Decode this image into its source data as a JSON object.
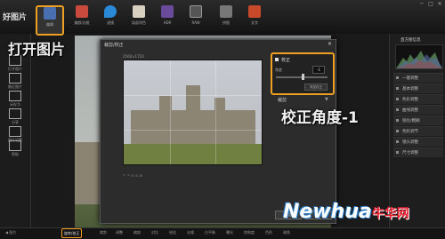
{
  "app": {
    "logo": "好图片",
    "window_controls": [
      "─",
      "□",
      "✕"
    ]
  },
  "toolbar": [
    {
      "label": "编辑",
      "icon": "edit-icon"
    },
    {
      "label": "美颜/边框",
      "icon": "brush-icon"
    },
    {
      "label": "滤镜",
      "icon": "drop-icon"
    },
    {
      "label": "局部涂色",
      "icon": "paint-icon"
    },
    {
      "label": "HDR",
      "icon": "hdr-icon"
    },
    {
      "label": "RAW",
      "icon": "raw-icon"
    },
    {
      "label": "拼图",
      "icon": "collage-icon"
    },
    {
      "label": "文字",
      "icon": "text-icon"
    }
  ],
  "left_panel": [
    {
      "label": "打开图片",
      "icon": "open-icon"
    },
    {
      "label": "最近图片",
      "icon": "recent-icon"
    },
    {
      "label": "另存为",
      "icon": "save-icon"
    },
    {
      "label": "分享",
      "icon": "share-icon"
    },
    {
      "label": "图片设置",
      "icon": "settings-icon"
    },
    {
      "label": "帮助",
      "icon": "help-icon"
    }
  ],
  "dialog": {
    "title": "裁剪/校正",
    "image_size": "2560×1710",
    "rotate": {
      "title": "校正",
      "angle_label": "角度",
      "angle_value": "-1",
      "reset_label": "恢复校正"
    },
    "crop": {
      "title": "裁剪",
      "toggle": "▼"
    },
    "bottom_bar": "↶ ↷ ⊞ ⊟ ⊠",
    "ok_label": "确定",
    "cancel_label": "取消"
  },
  "right_panel": {
    "histogram_title": "直方图信息",
    "items": [
      "一键调整",
      "基本调整",
      "色彩调整",
      "曲线调整",
      "锐化/模糊",
      "色阶调节",
      "镜头调整",
      "尺寸调整"
    ]
  },
  "bottom_bar": {
    "left_label": "◀ 图片",
    "items": [
      "旋转/校正",
      "裁剪",
      "调整",
      "缩放",
      "对比",
      "锐化",
      "去噪",
      "白平衡",
      "曝光",
      "饱和度",
      "色阶",
      "暗角"
    ]
  },
  "annotations": {
    "open_image": "打开图片",
    "rotate_note": "校正角度-1"
  },
  "watermark": {
    "brand": "Newhua",
    "suffix": "牛华网"
  },
  "colors": {
    "highlight": "#f0a020"
  }
}
